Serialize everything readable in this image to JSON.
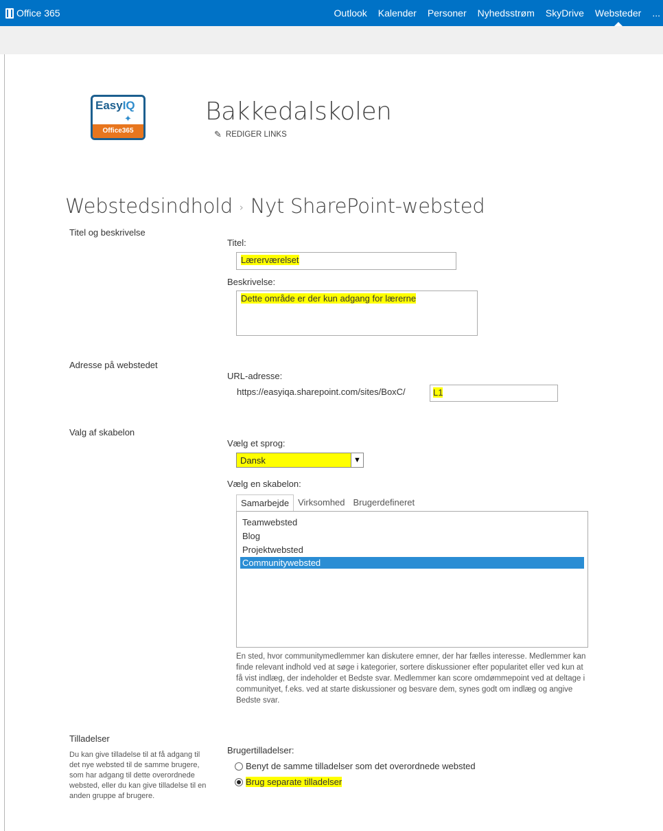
{
  "suitebar": {
    "brand": "Office 365",
    "nav": [
      "Outlook",
      "Kalender",
      "Personer",
      "Nyhedsstrøm",
      "SkyDrive",
      "Websteder",
      "..."
    ]
  },
  "site": {
    "logo_top_1": "Easy",
    "logo_top_2": "IQ",
    "logo_bottom": "Office365",
    "title": "Bakkedalskolen",
    "edit_links": "REDIGER LINKS"
  },
  "breadcrumb": {
    "parent": "Webstedsindhold",
    "separator": "›",
    "current": "Nyt SharePoint-websted"
  },
  "form": {
    "section_title": "Titel og beskrivelse",
    "title_label": "Titel:",
    "title_value": "Lærerværelset",
    "desc_label": "Beskrivelse:",
    "desc_value": "Dette område er der kun adgang for lærerne",
    "section_address": "Adresse på webstedet",
    "url_label": "URL-adresse:",
    "url_prefix": "https://easyiqa.sharepoint.com/sites/BoxC/",
    "url_value": "L1",
    "section_template": "Valg af skabelon",
    "lang_label": "Vælg et sprog:",
    "lang_value": "Dansk",
    "tpl_label": "Vælg en skabelon:",
    "tabs": [
      "Samarbejde",
      "Virksomhed",
      "Brugerdefineret"
    ],
    "templates": [
      "Teamwebsted",
      "Blog",
      "Projektwebsted",
      "Communitywebsted"
    ],
    "selected_template": "Communitywebsted",
    "tpl_description": "En sted, hvor communitymedlemmer kan diskutere emner, der har fælles interesse. Medlemmer kan finde relevant indhold ved at søge i kategorier, sortere diskussioner efter popularitet eller ved kun at få vist indlæg, der indeholder et Bedste svar. Medlemmer kan score omdømmepoint ved at deltage i communityet, f.eks. ved at starte diskussioner og besvare dem, synes godt om indlæg og angive Bedste svar.",
    "section_permissions": "Tilladelser",
    "perm_desc": "Du kan give tilladelse til at få adgang til det nye websted til de samme brugere, som har adgang til dette overordnede websted, eller du kan give tilladelse til en anden gruppe af brugere.",
    "perm_label": "Brugertilladelser:",
    "perm_option_1": "Benyt de samme tilladelser som det overordnede websted",
    "perm_option_2": "Brug separate tilladelser",
    "perm_selected": 2
  }
}
